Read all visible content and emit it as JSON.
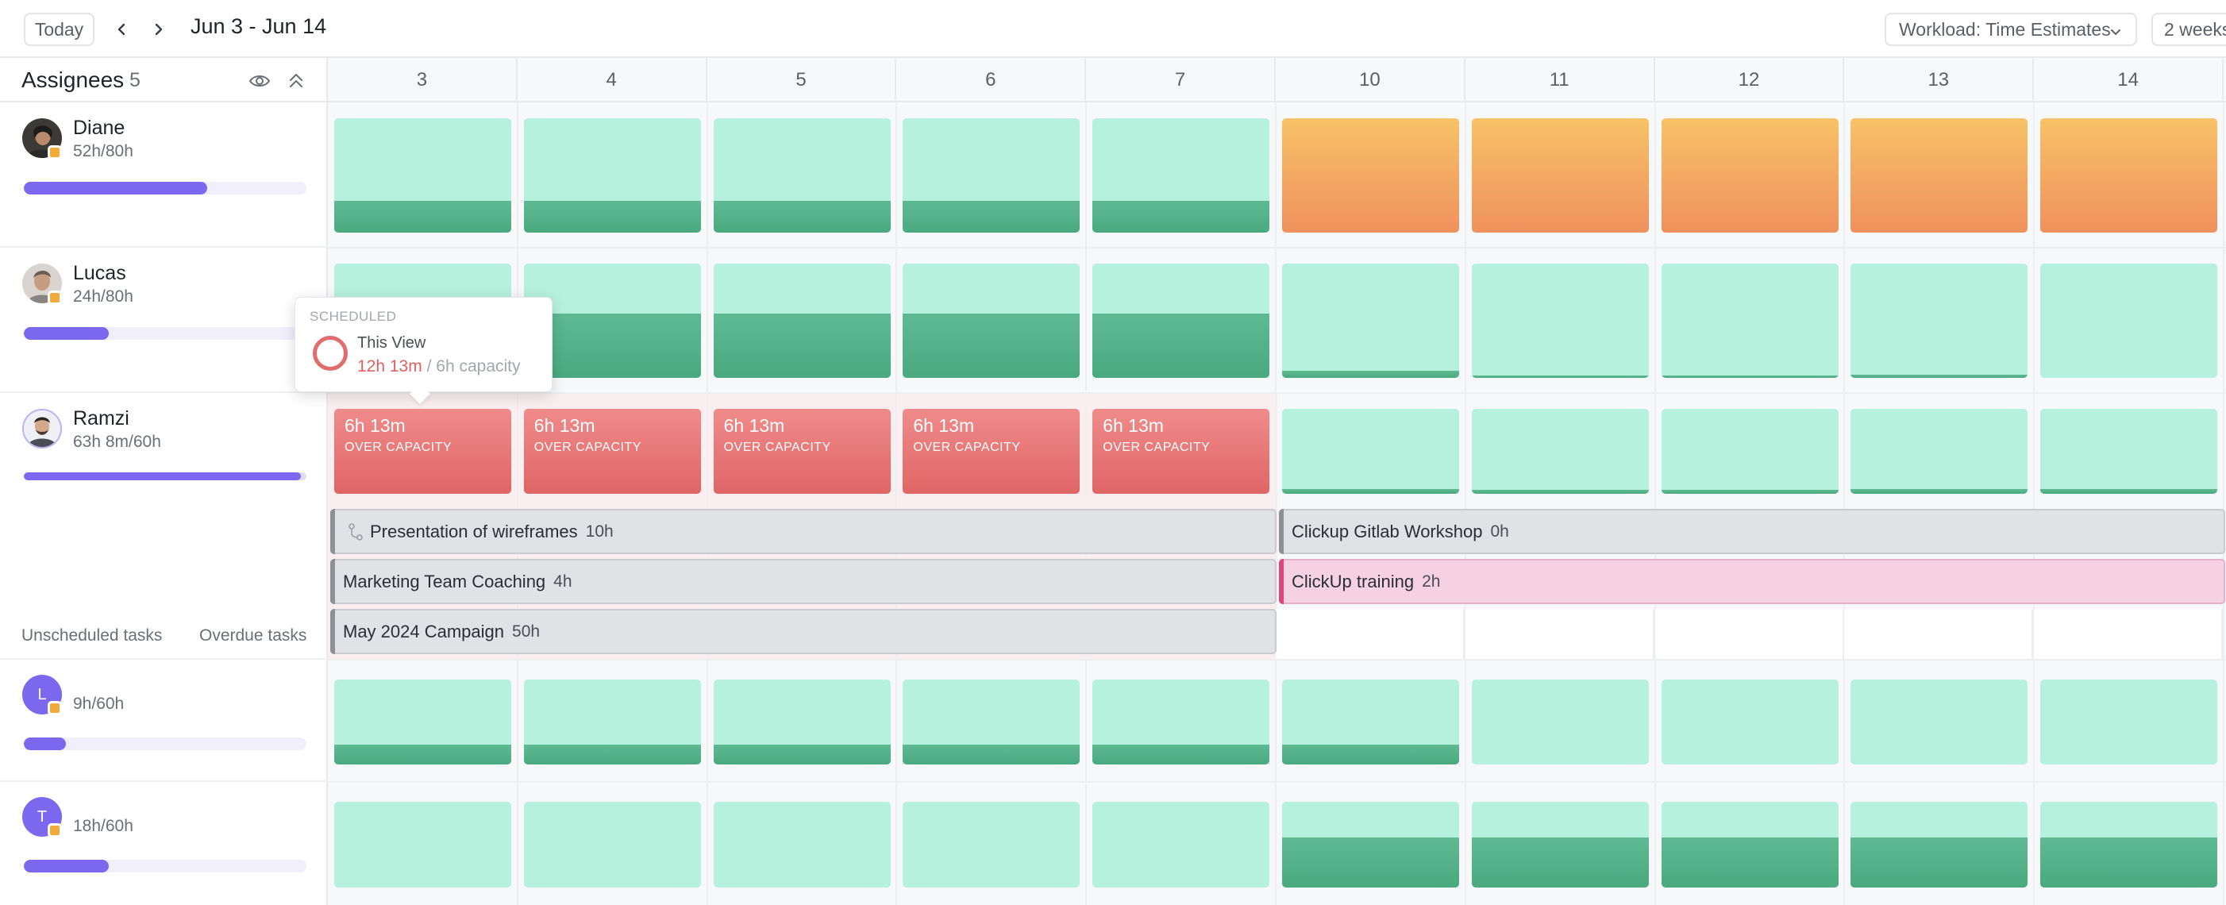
{
  "toolbar": {
    "today_label": "Today",
    "date_range": "Jun 3 - Jun 14",
    "workload_select": "Workload: Time Estimates",
    "period_select": "2 weeks"
  },
  "assignees": {
    "title": "Assignees",
    "count": "5",
    "people": [
      {
        "name": "Diane",
        "hours": "52h/80h",
        "progress": 0.65
      },
      {
        "name": "Lucas",
        "hours": "24h/80h",
        "progress": 0.3
      },
      {
        "name": "Ramzi",
        "hours": "63h 8m/60h",
        "progress": 1.0
      },
      {
        "avatar_letter": "L",
        "hours": "9h/60h",
        "progress": 0.15
      },
      {
        "avatar_letter": "T",
        "hours": "18h/60h",
        "progress": 0.3
      }
    ],
    "unscheduled_label": "Unscheduled tasks",
    "overdue_label": "Overdue tasks"
  },
  "days": [
    "3",
    "4",
    "5",
    "6",
    "7",
    "10",
    "11",
    "12",
    "13",
    "14"
  ],
  "workload": {
    "diane": {
      "week1_fill": 0.28,
      "week2": "over"
    },
    "lucas": {
      "fills": [
        0.55,
        0.56,
        0.56,
        0.56,
        0.56,
        0.06,
        0.02,
        0.02,
        0.03,
        0.0
      ]
    },
    "ramzi": {
      "over_capacity_label": "OVER CAPACITY",
      "over_days": [
        "6h 13m",
        "6h 13m",
        "6h 13m",
        "6h 13m",
        "6h 13m"
      ],
      "week2_fills": [
        0.06,
        0.05,
        0.05,
        0.06,
        0.06
      ]
    },
    "person4": {
      "fills": [
        0.23,
        0.23,
        0.23,
        0.23,
        0.23,
        0.23,
        0,
        0,
        0,
        0
      ]
    },
    "person5": {
      "fills": [
        0,
        0,
        0,
        0,
        0,
        0.58,
        0.58,
        0.58,
        0.58,
        0.58
      ]
    }
  },
  "tasks": [
    {
      "name": "Presentation of wireframes",
      "duration": "10h",
      "icon": "dependency-icon"
    },
    {
      "name": "Clickup Gitlab Workshop",
      "duration": "0h"
    },
    {
      "name": "Marketing Team Coaching",
      "duration": "4h"
    },
    {
      "name": "ClickUp training",
      "duration": "2h",
      "color": "#e0457b"
    },
    {
      "name": "May 2024 Campaign",
      "duration": "50h"
    }
  ],
  "tooltip": {
    "heading": "SCHEDULED",
    "view_label": "This View",
    "scheduled": "12h 13m",
    "separator": "/",
    "capacity": "6h capacity"
  },
  "colors": {
    "accent": "#7b68ee",
    "capacity_light": "#b6f1dd",
    "capacity_fill": "#4aa97f",
    "over_capacity": "#e06565",
    "overbooked_orange": "#f0915e"
  }
}
